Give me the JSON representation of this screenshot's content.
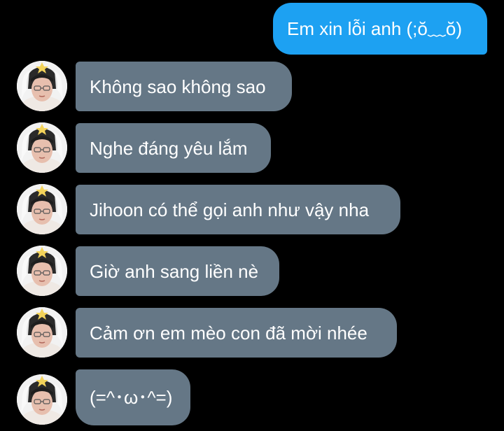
{
  "messages": [
    {
      "direction": "outgoing",
      "text": "Em xin lỗi anh (;ŏ﹏ŏ)"
    },
    {
      "direction": "incoming",
      "text": "Không sao không sao"
    },
    {
      "direction": "incoming",
      "text": "Nghe đáng yêu lắm"
    },
    {
      "direction": "incoming",
      "text": "Jihoon có thể gọi anh như vậy nha"
    },
    {
      "direction": "incoming",
      "text": "Giờ anh sang liền nè"
    },
    {
      "direction": "incoming",
      "text": "Cảm ơn em mèo con đã mời nhée"
    },
    {
      "direction": "incoming",
      "text": "(=^･ω･^=)"
    }
  ],
  "colors": {
    "background": "#000000",
    "outgoing_bubble": "#1da1f2",
    "incoming_bubble": "#657786",
    "text": "#ffffff"
  },
  "avatar_icon": "profile-photo"
}
